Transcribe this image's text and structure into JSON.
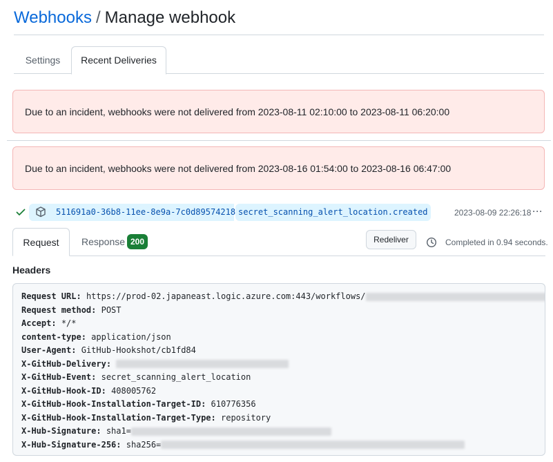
{
  "breadcrumb": {
    "parent": "Webhooks",
    "separator": "/",
    "current": "Manage webhook"
  },
  "tabs": {
    "settings": "Settings",
    "recent": "Recent Deliveries"
  },
  "alerts": [
    "Due to an incident, webhooks were not delivered from 2023-08-11 02:10:00 to 2023-08-11 06:20:00",
    "Due to an incident, webhooks were not delivered from 2023-08-16 01:54:00 to 2023-08-16 06:47:00"
  ],
  "delivery": {
    "guid": "511691a0-36b8-11ee-8e9a-7c0d89574218",
    "event": "secret_scanning_alert_location.created",
    "timestamp": "2023-08-09 22:26:18",
    "more": "···"
  },
  "detail": {
    "request_tab": "Request",
    "response_tab": "Response",
    "status_code": "200",
    "redeliver": "Redeliver",
    "completed": "Completed in 0.94 seconds."
  },
  "headers": {
    "label": "Headers",
    "lines": [
      {
        "key": "Request URL:",
        "value": "https://prod-02.japaneast.logic.azure.com:443/workflows/"
      },
      {
        "key": "Request method:",
        "value": "POST"
      },
      {
        "key": "Accept:",
        "value": "*/*"
      },
      {
        "key": "content-type:",
        "value": "application/json"
      },
      {
        "key": "User-Agent:",
        "value": "GitHub-Hookshot/cb1fd84"
      },
      {
        "key": "X-GitHub-Delivery:",
        "value": ""
      },
      {
        "key": "X-GitHub-Event:",
        "value": "secret_scanning_alert_location"
      },
      {
        "key": "X-GitHub-Hook-ID:",
        "value": "408005762"
      },
      {
        "key": "X-GitHub-Hook-Installation-Target-ID:",
        "value": "610776356"
      },
      {
        "key": "X-GitHub-Hook-Installation-Target-Type:",
        "value": "repository"
      },
      {
        "key": "X-Hub-Signature:",
        "value": "sha1="
      },
      {
        "key": "X-Hub-Signature-256:",
        "value": "sha256="
      }
    ]
  },
  "colors": {
    "link": "#0969da",
    "alert_bg": "#ffebe9",
    "success": "#1a7f37",
    "pill_bg": "#ddf4ff"
  }
}
